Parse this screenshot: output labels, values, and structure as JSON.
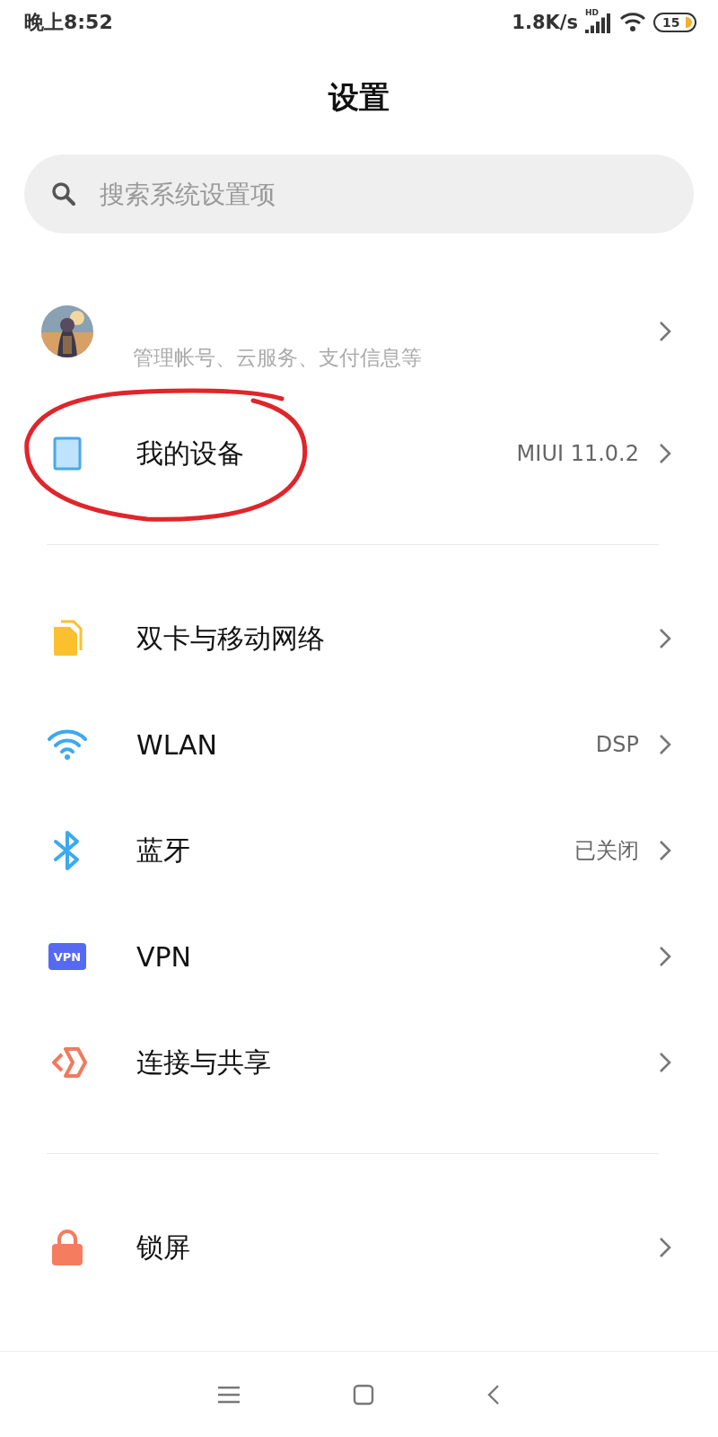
{
  "status_bar": {
    "time": "晚上8:52",
    "speed": "1.8K/s",
    "network_type": "HD",
    "battery": "15"
  },
  "title": "设置",
  "search": {
    "placeholder": "搜索系统设置项"
  },
  "sections": [
    {
      "items": [
        {
          "kind": "account",
          "subtitle": "管理帐号、云服务、支付信息等"
        },
        {
          "kind": "device",
          "label": "我的设备",
          "value": "MIUI 11.0.2",
          "circled": true
        }
      ]
    },
    {
      "items": [
        {
          "kind": "sim",
          "label": "双卡与移动网络"
        },
        {
          "kind": "wifi",
          "label": "WLAN",
          "value": "DSP"
        },
        {
          "kind": "bluetooth",
          "label": "蓝牙",
          "value": "已关闭"
        },
        {
          "kind": "vpn",
          "label": "VPN",
          "icon_text": "VPN"
        },
        {
          "kind": "share",
          "label": "连接与共享"
        }
      ]
    },
    {
      "items": [
        {
          "kind": "lock",
          "label": "锁屏"
        }
      ]
    }
  ]
}
